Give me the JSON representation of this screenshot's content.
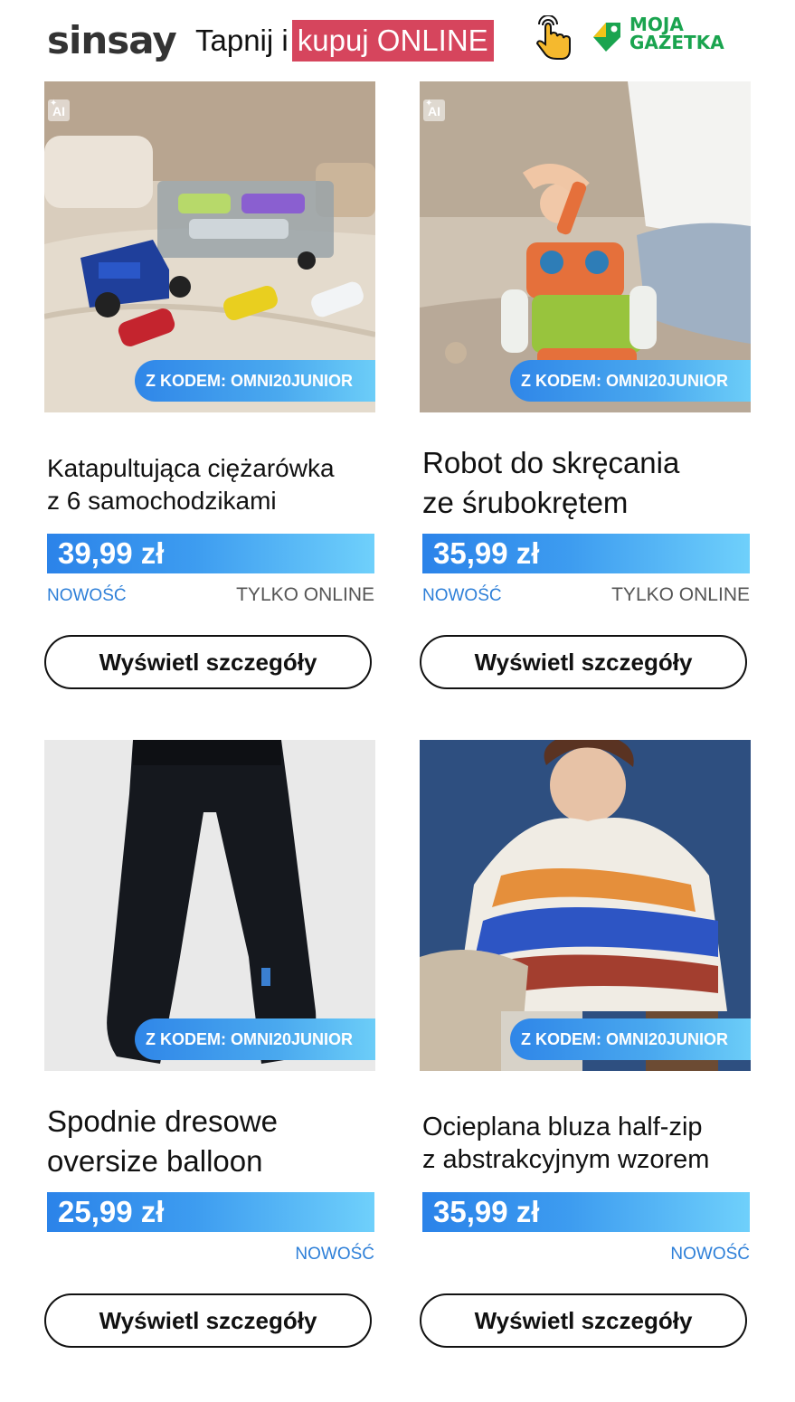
{
  "header": {
    "logo": "sinsay",
    "tagline_plain": "Tapnij i",
    "tagline_highlight": "kupuj ONLINE",
    "partner_line1": "MOJA",
    "partner_line2": "GAZETKA"
  },
  "products": [
    {
      "ai_label": "AI",
      "code_label": "Z KODEM: OMNI20JUNIOR",
      "title_line1": "Katapultująca ciężarówka",
      "title_line2": "z 6 samochodzikami",
      "price": "39,99 zł",
      "badge_new": "NOWOŚĆ",
      "badge_online": "TYLKO ONLINE",
      "button": "Wyświetl szczegóły"
    },
    {
      "ai_label": "AI",
      "code_label": "Z KODEM: OMNI20JUNIOR",
      "title_line1": "Robot do skręcania",
      "title_line2": "ze śrubokrętem",
      "price": "35,99 zł",
      "badge_new": "NOWOŚĆ",
      "badge_online": "TYLKO ONLINE",
      "button": "Wyświetl szczegóły"
    },
    {
      "code_label": "Z KODEM: OMNI20JUNIOR",
      "title_line1": "Spodnie dresowe",
      "title_line2": "oversize balloon",
      "price": "25,99 zł",
      "badge_new": "NOWOŚĆ",
      "button": "Wyświetl szczegóły"
    },
    {
      "code_label": "Z KODEM: OMNI20JUNIOR",
      "title_line1": "Ocieplana bluza half-zip",
      "title_line2": "z abstrakcyjnym wzorem",
      "price": "35,99 zł",
      "badge_new": "NOWOŚĆ",
      "button": "Wyświetl szczegóły"
    }
  ],
  "colors": {
    "accent_pink": "#d6455d",
    "price_blue": "#2b83e9",
    "partner_green": "#1aa44f"
  }
}
